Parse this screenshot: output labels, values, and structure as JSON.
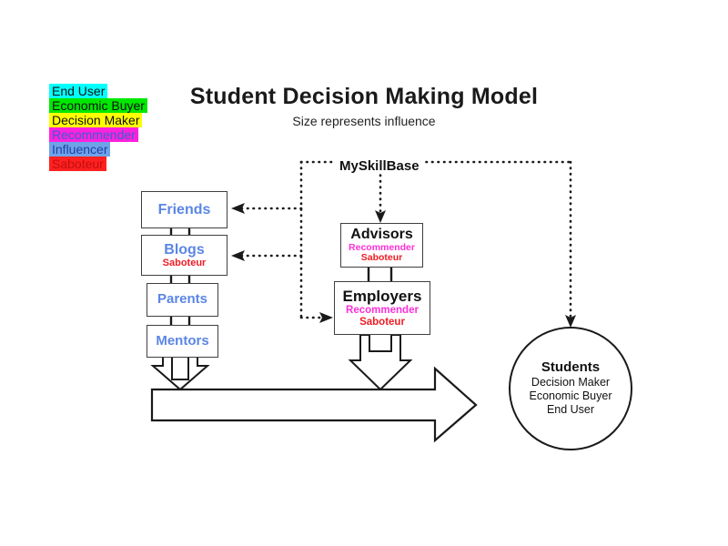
{
  "title": "Student Decision Making Model",
  "subtitle": "Size represents influence",
  "legend": {
    "name": "role-legend",
    "items": [
      {
        "label": "End User",
        "bg": "#00ffff",
        "fg": "#111111"
      },
      {
        "label": "Economic Buyer",
        "bg": "#00e800",
        "fg": "#111111"
      },
      {
        "label": "Decision Maker",
        "bg": "#ffff00",
        "fg": "#111111"
      },
      {
        "label": "Recommender",
        "bg": "#ff22dd",
        "fg": "#3a5fd0"
      },
      {
        "label": "Influencer",
        "bg": "#6fa3e8",
        "fg": "#1f3fa8"
      },
      {
        "label": "Saboteur",
        "bg": "#ff2020",
        "fg": "#c21010"
      }
    ]
  },
  "system_label": "MySkillBase",
  "nodes": {
    "friends": {
      "title": "Friends",
      "roles": []
    },
    "blogs": {
      "title": "Blogs",
      "roles": [
        "Saboteur"
      ]
    },
    "parents": {
      "title": "Parents",
      "roles": []
    },
    "mentors": {
      "title": "Mentors",
      "roles": []
    },
    "advisors": {
      "title": "Advisors",
      "role1": "Recommender",
      "role2": "Saboteur"
    },
    "employers": {
      "title": "Employers",
      "role1": "Recommender",
      "role2": "Saboteur"
    },
    "students": {
      "title": "Students",
      "role1": "Decision Maker",
      "role2": "Economic Buyer",
      "role3": "End User"
    }
  },
  "colors": {
    "influencer": "#5b86e5",
    "recommender": "#ff2fd8",
    "saboteur": "#ee1c25",
    "black": "#111111",
    "box_border": "#3f3f3f",
    "line": "#1a1a1a"
  }
}
